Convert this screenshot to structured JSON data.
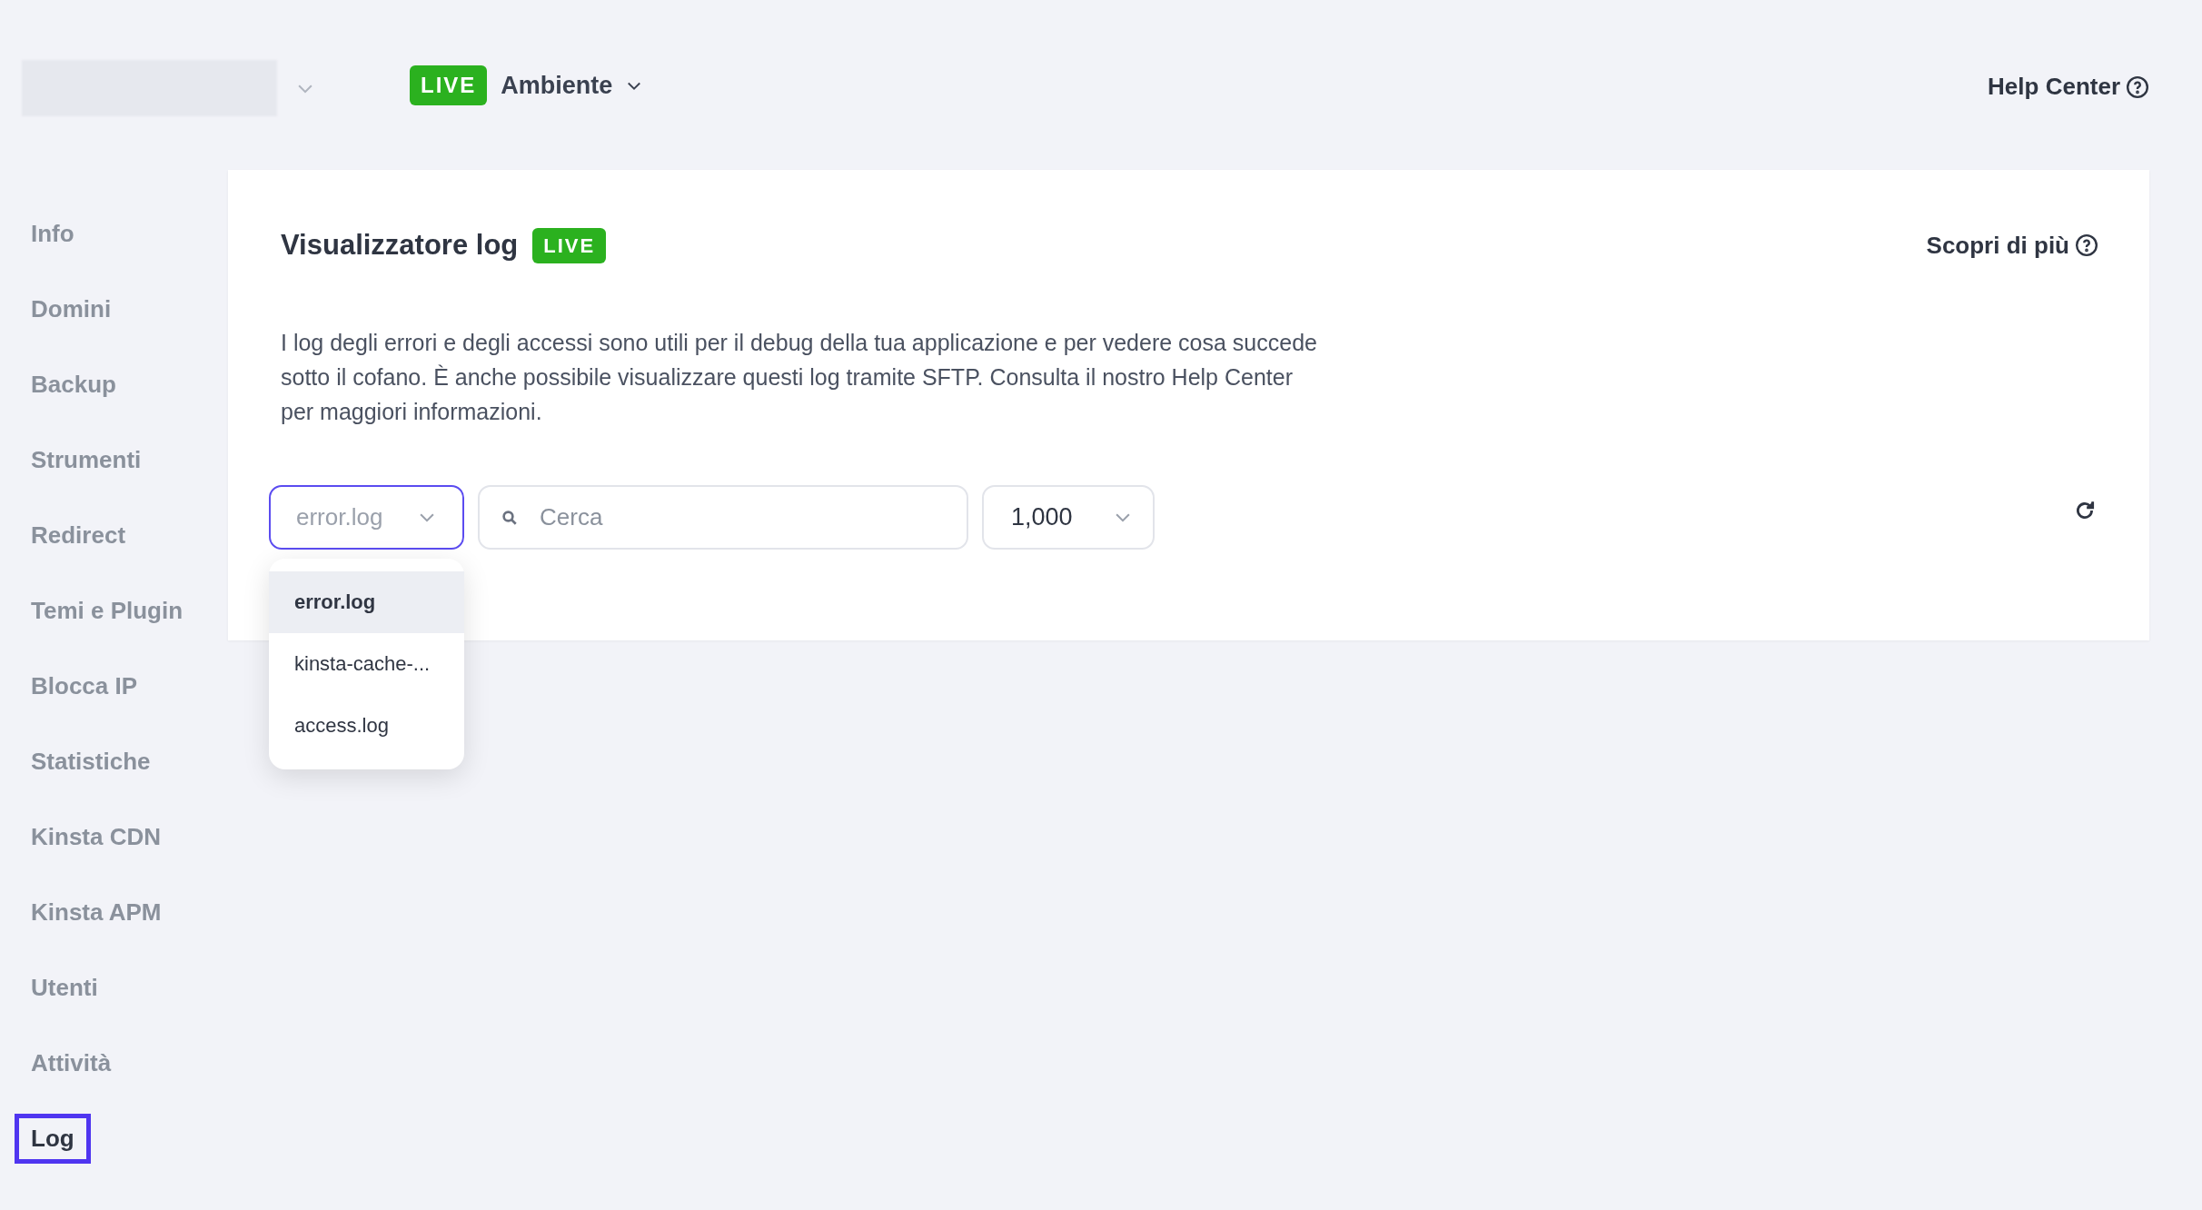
{
  "topbar": {
    "environment_badge": "LIVE",
    "environment_label": "Ambiente",
    "help_link": "Help Center"
  },
  "sidebar": {
    "items": [
      {
        "label": "Info",
        "selected": false
      },
      {
        "label": "Domini",
        "selected": false
      },
      {
        "label": "Backup",
        "selected": false
      },
      {
        "label": "Strumenti",
        "selected": false
      },
      {
        "label": "Redirect",
        "selected": false
      },
      {
        "label": "Temi e Plugin",
        "selected": false
      },
      {
        "label": "Blocca IP",
        "selected": false
      },
      {
        "label": "Statistiche",
        "selected": false
      },
      {
        "label": "Kinsta CDN",
        "selected": false
      },
      {
        "label": "Kinsta APM",
        "selected": false
      },
      {
        "label": "Utenti",
        "selected": false
      },
      {
        "label": "Attività",
        "selected": false
      },
      {
        "label": "Log",
        "selected": true
      }
    ]
  },
  "card": {
    "title": "Visualizzatore log",
    "badge": "LIVE",
    "learn_more": "Scopri di più",
    "description": "I log degli errori e degli accessi sono utili per il debug della tua applicazione e per vedere cosa succede sotto il cofano. È anche possibile visualizzare questi log tramite SFTP. Consulta il nostro Help Center per maggiori informazioni.",
    "file_select": {
      "value": "error.log",
      "expanded": true,
      "options": [
        {
          "label": "error.log",
          "selected": true
        },
        {
          "label": "kinsta-cache-...",
          "selected": false
        },
        {
          "label": "access.log",
          "selected": false
        }
      ]
    },
    "search": {
      "placeholder": "Cerca"
    },
    "lines_select": {
      "value": "1,000"
    }
  }
}
